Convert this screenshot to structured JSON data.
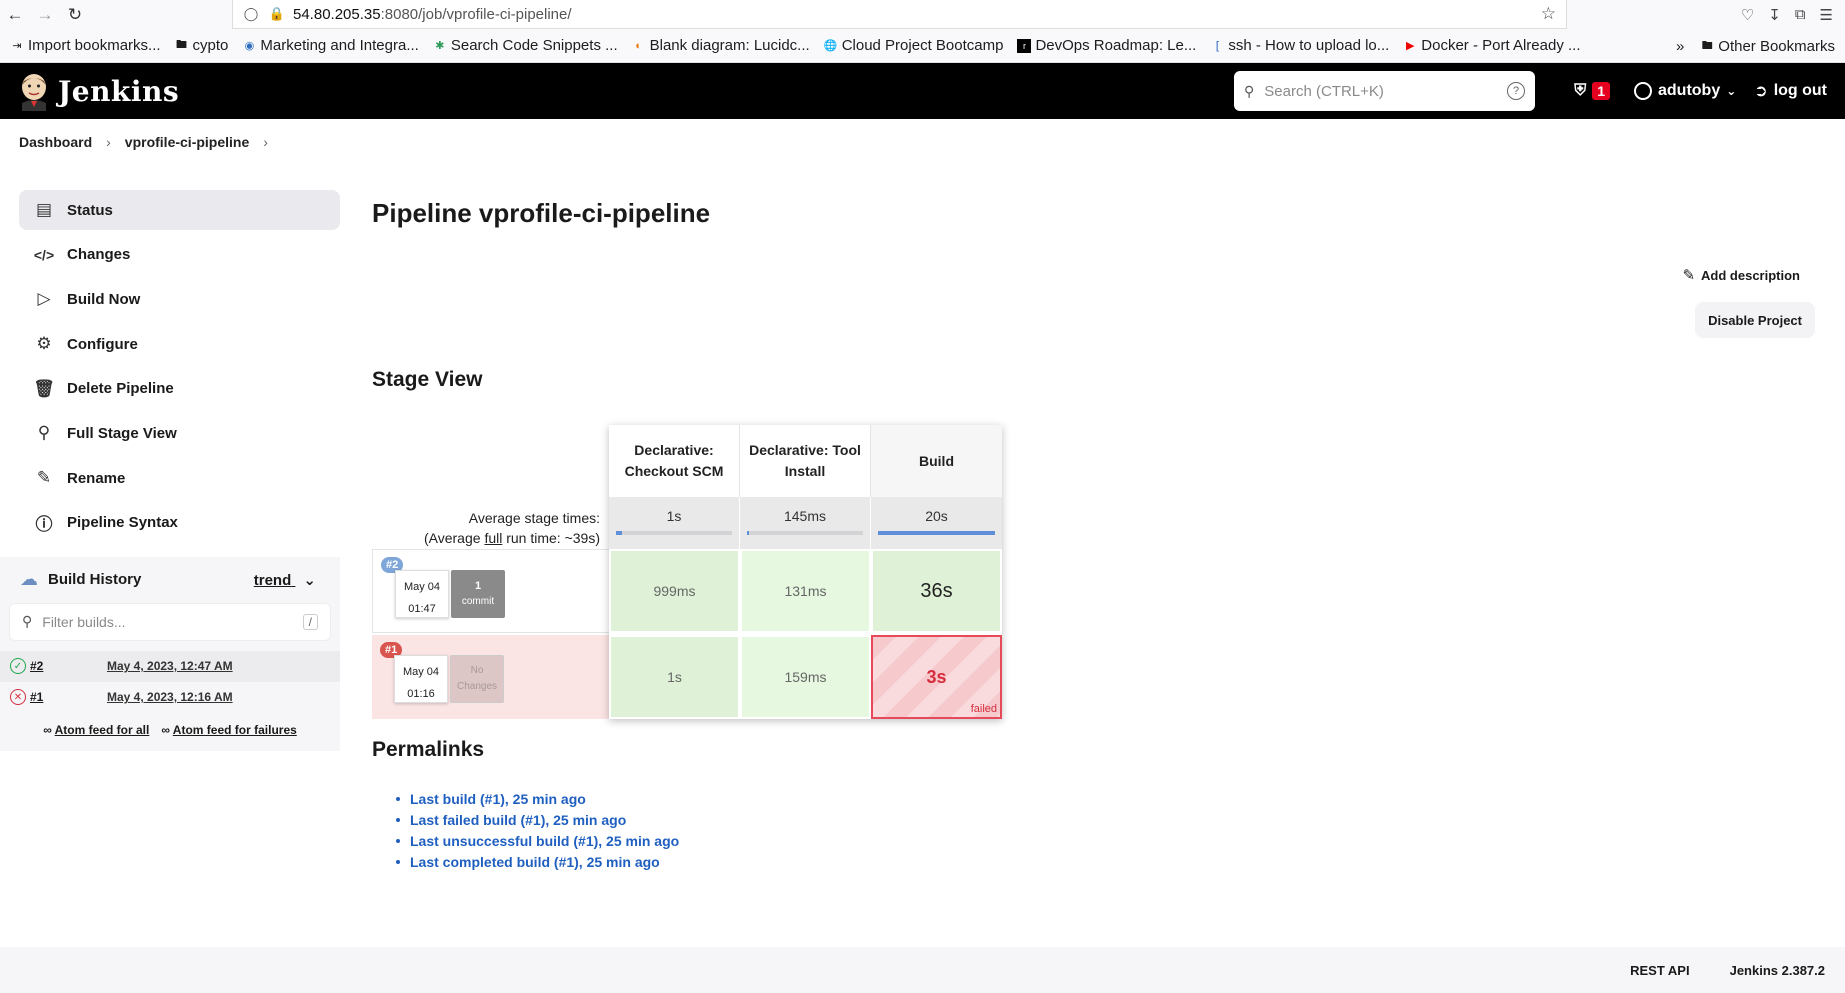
{
  "browser": {
    "url_host": "54.80.205.35",
    "url_rest": ":8080/job/vprofile-ci-pipeline/",
    "bookmarks": [
      "Import bookmarks...",
      "cypto",
      "Marketing and Integra...",
      "Search Code Snippets ...",
      "Blank diagram: Lucidc...",
      "Cloud Project Bootcamp",
      "DevOps Roadmap: Le...",
      "ssh - How to upload lo...",
      "Docker - Port Already ..."
    ],
    "other_bookmarks": "Other Bookmarks"
  },
  "header": {
    "brand": "Jenkins",
    "search_placeholder": "Search (CTRL+K)",
    "security_count": "1",
    "username": "adutoby",
    "logout": "log out"
  },
  "breadcrumb": [
    "Dashboard",
    "vprofile-ci-pipeline"
  ],
  "sidebar": {
    "tasks": [
      {
        "label": "Status",
        "icon": "status-icon"
      },
      {
        "label": "Changes",
        "icon": "code-icon"
      },
      {
        "label": "Build Now",
        "icon": "play-icon"
      },
      {
        "label": "Configure",
        "icon": "gear-icon"
      },
      {
        "label": "Delete Pipeline",
        "icon": "trash-icon"
      },
      {
        "label": "Full Stage View",
        "icon": "search-icon"
      },
      {
        "label": "Rename",
        "icon": "pencil-icon"
      },
      {
        "label": "Pipeline Syntax",
        "icon": "help-icon"
      }
    ],
    "build_history": {
      "title": "Build History",
      "trend": "trend",
      "filter_placeholder": "Filter builds...",
      "filter_shortcut": "/",
      "builds": [
        {
          "number": "#2",
          "date": "May 4, 2023, 12:47 AM",
          "status": "success"
        },
        {
          "number": "#1",
          "date": "May 4, 2023, 12:16 AM",
          "status": "failed"
        }
      ],
      "feed_all": "Atom feed for all",
      "feed_failures": "Atom feed for failures"
    }
  },
  "main": {
    "title": "Pipeline vprofile-ci-pipeline",
    "add_description": "Add description",
    "disable_project": "Disable Project",
    "stage_view_title": "Stage View",
    "stages": [
      "Declarative: Checkout SCM",
      "Declarative: Tool Install",
      "Build"
    ],
    "avg_label_1": "Average stage times:",
    "avg_label_2_pre": "(Average ",
    "avg_label_2_u": "full",
    "avg_label_2_post": " run time: ~39s)",
    "averages": [
      {
        "value": "1s",
        "fill_fraction": 0.05
      },
      {
        "value": "145ms",
        "fill_fraction": 0.01
      },
      {
        "value": "20s",
        "fill_fraction": 1.0
      }
    ],
    "runs": [
      {
        "badge": "#2",
        "badge_color": "#7fa6d9",
        "date": "May 04",
        "time": "01:47",
        "changes_line1": "1",
        "changes_line2": "commit",
        "cells": [
          "999ms",
          "131ms",
          "36s"
        ],
        "status": "success"
      },
      {
        "badge": "#1",
        "badge_color": "#d9534f",
        "date": "May 04",
        "time": "01:16",
        "changes_line1": "No",
        "changes_line2": "Changes",
        "cells": [
          "1s",
          "159ms",
          "3s"
        ],
        "failed_label": "failed",
        "status": "failed"
      }
    ],
    "permalinks_title": "Permalinks",
    "permalinks": [
      "Last build (#1), 25 min ago",
      "Last failed build (#1), 25 min ago",
      "Last unsuccessful build (#1), 25 min ago",
      "Last completed build (#1), 25 min ago"
    ]
  },
  "footer": {
    "rest_api": "REST API",
    "version": "Jenkins 2.387.2"
  },
  "colors": {
    "header_bg": "#000000",
    "link": "#1f5fc0",
    "success_cell": "#dff2d7",
    "failed_border": "#e64a5a",
    "security_badge": "#e6001f"
  }
}
